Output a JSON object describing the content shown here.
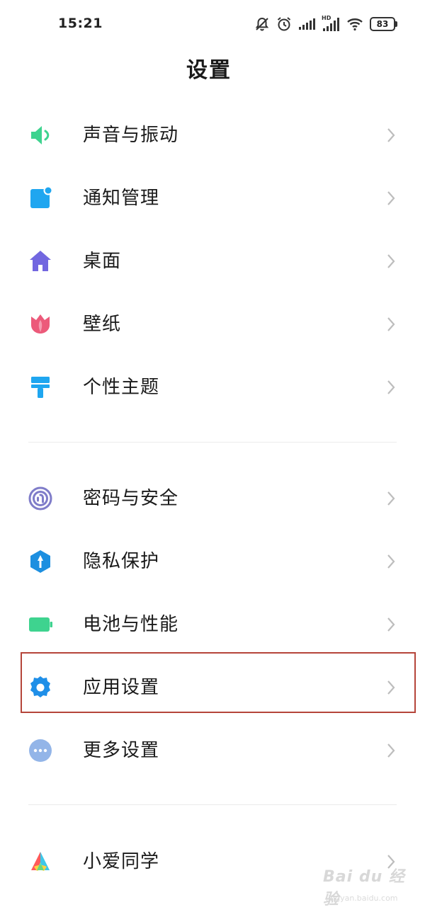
{
  "status_bar": {
    "time": "15:21",
    "battery_level": "83",
    "network_label": "HD",
    "icons": [
      "mute-bell-icon",
      "alarm-icon",
      "signal-icon",
      "hd-signal-icon",
      "wifi-icon",
      "battery-icon"
    ]
  },
  "header": {
    "title": "设置"
  },
  "settings": {
    "items": [
      {
        "label": "声音与振动",
        "icon": "speaker-icon",
        "color": "#3ed38f"
      },
      {
        "label": "通知管理",
        "icon": "notification-icon",
        "color": "#1fa6f0"
      },
      {
        "label": "桌面",
        "icon": "home-icon",
        "color": "#7267e0"
      },
      {
        "label": "壁纸",
        "icon": "tulip-icon",
        "color": "#ec5a7a"
      },
      {
        "label": "个性主题",
        "icon": "paintbrush-icon",
        "color": "#1fa6f0"
      },
      {
        "label": "密码与安全",
        "icon": "fingerprint-icon",
        "color": "#7f7cc9"
      },
      {
        "label": "隐私保护",
        "icon": "privacy-shield-icon",
        "color": "#1d8fe0"
      },
      {
        "label": "电池与性能",
        "icon": "battery-performance-icon",
        "color": "#3ed38f"
      },
      {
        "label": "应用设置",
        "icon": "gear-icon",
        "color": "#1f8fe8"
      },
      {
        "label": "更多设置",
        "icon": "more-dots-icon",
        "color": "#93b5e8"
      },
      {
        "label": "小爱同学",
        "icon": "xiaoai-icon",
        "color": "#ff5a5a"
      }
    ]
  },
  "watermark": {
    "main": "Bai du 经验",
    "sub": "jingyan.baidu.com"
  }
}
